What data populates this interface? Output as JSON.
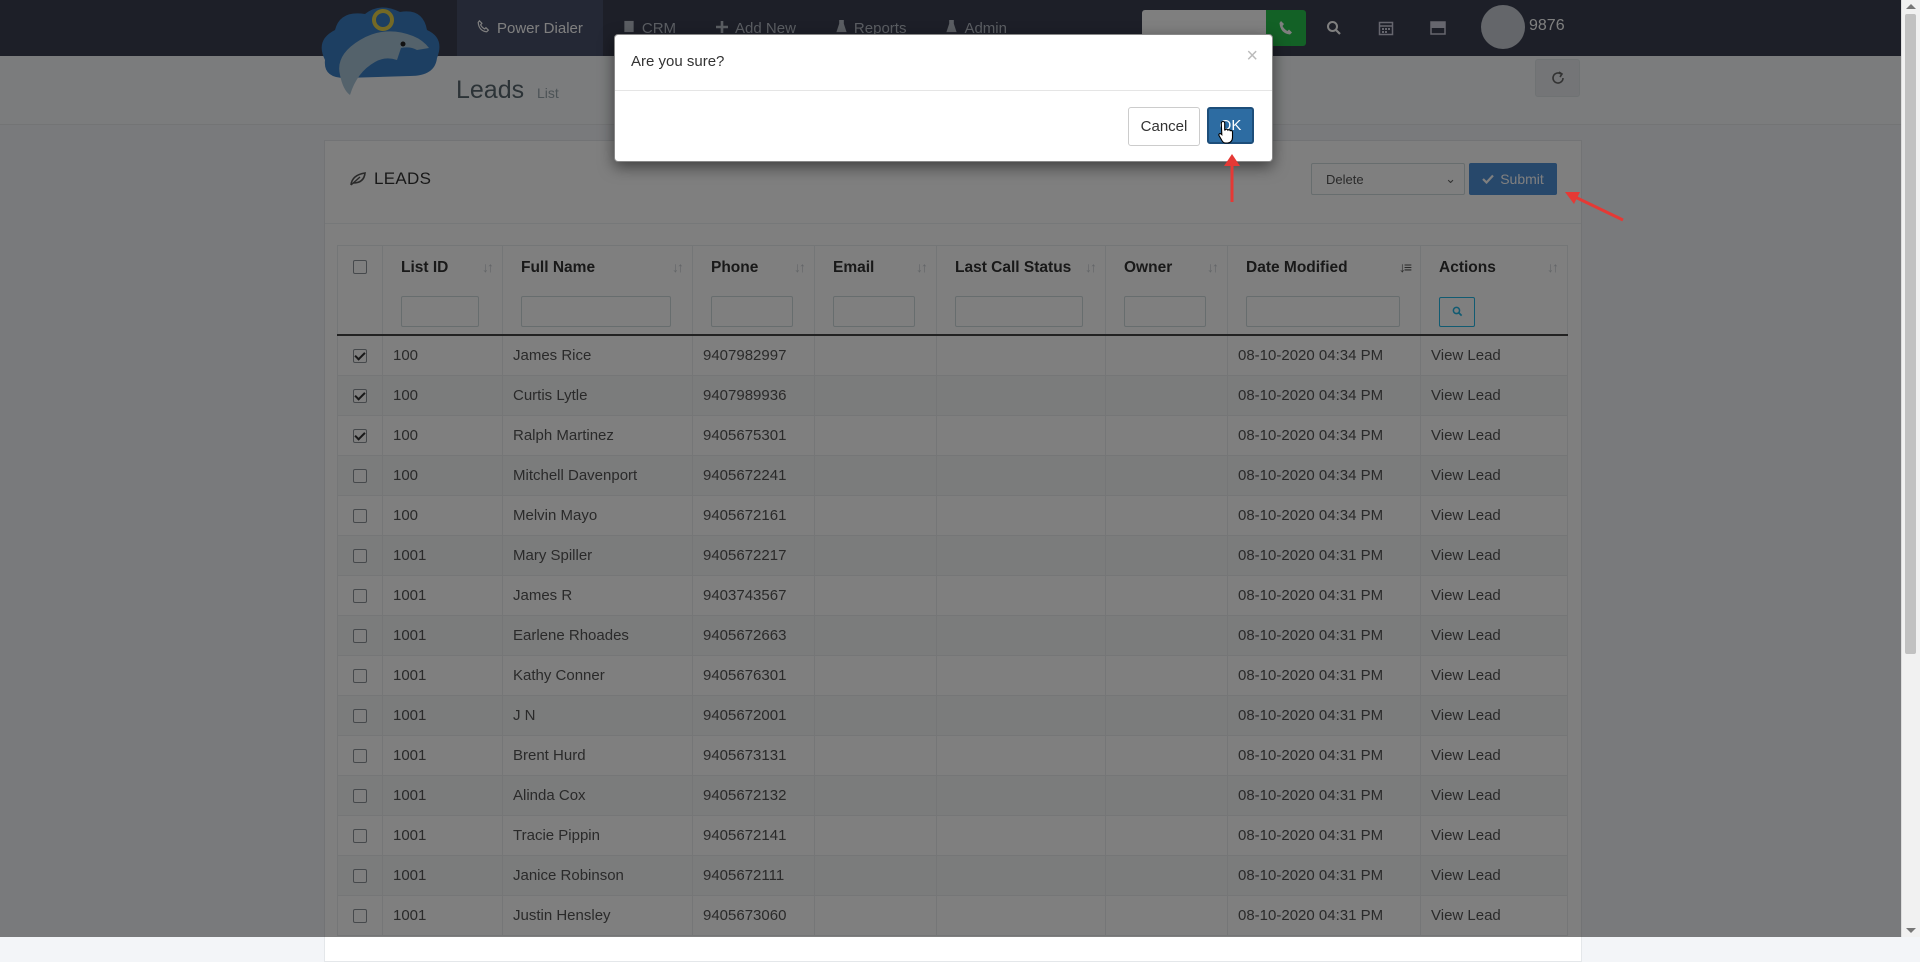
{
  "nav": {
    "items": [
      {
        "label": "Power Dialer",
        "icon": "phone-icon",
        "active": true
      },
      {
        "label": "CRM",
        "icon": "book-icon",
        "active": false
      },
      {
        "label": "Add New",
        "icon": "plus-icon",
        "active": false
      },
      {
        "label": "Reports",
        "icon": "flask-icon",
        "active": false
      },
      {
        "label": "Admin",
        "icon": "flask-icon",
        "active": false
      }
    ],
    "user_ext": "9876"
  },
  "header": {
    "title": "Leads",
    "subtitle": "List"
  },
  "panel": {
    "title": "LEADS",
    "action_selected": "Delete",
    "submit_label": "Submit"
  },
  "table": {
    "columns": [
      "List ID",
      "Full Name",
      "Phone",
      "Email",
      "Last Call Status",
      "Owner",
      "Date Modified",
      "Actions"
    ],
    "rows": [
      {
        "checked": true,
        "list_id": "100",
        "name": "James Rice",
        "phone": "9407982997",
        "email": "",
        "status": "",
        "owner": "",
        "date": "08-10-2020 04:34 PM",
        "action": "View Lead"
      },
      {
        "checked": true,
        "list_id": "100",
        "name": "Curtis Lytle",
        "phone": "9407989936",
        "email": "",
        "status": "",
        "owner": "",
        "date": "08-10-2020 04:34 PM",
        "action": "View Lead"
      },
      {
        "checked": true,
        "list_id": "100",
        "name": "Ralph Martinez",
        "phone": "9405675301",
        "email": "",
        "status": "",
        "owner": "",
        "date": "08-10-2020 04:34 PM",
        "action": "View Lead"
      },
      {
        "checked": false,
        "list_id": "100",
        "name": "Mitchell Davenport",
        "phone": "9405672241",
        "email": "",
        "status": "",
        "owner": "",
        "date": "08-10-2020 04:34 PM",
        "action": "View Lead"
      },
      {
        "checked": false,
        "list_id": "100",
        "name": "Melvin Mayo",
        "phone": "9405672161",
        "email": "",
        "status": "",
        "owner": "",
        "date": "08-10-2020 04:34 PM",
        "action": "View Lead"
      },
      {
        "checked": false,
        "list_id": "1001",
        "name": "Mary Spiller",
        "phone": "9405672217",
        "email": "",
        "status": "",
        "owner": "",
        "date": "08-10-2020 04:31 PM",
        "action": "View Lead"
      },
      {
        "checked": false,
        "list_id": "1001",
        "name": "James R",
        "phone": "9403743567",
        "email": "",
        "status": "",
        "owner": "",
        "date": "08-10-2020 04:31 PM",
        "action": "View Lead"
      },
      {
        "checked": false,
        "list_id": "1001",
        "name": "Earlene Rhoades",
        "phone": "9405672663",
        "email": "",
        "status": "",
        "owner": "",
        "date": "08-10-2020 04:31 PM",
        "action": "View Lead"
      },
      {
        "checked": false,
        "list_id": "1001",
        "name": "Kathy Conner",
        "phone": "9405676301",
        "email": "",
        "status": "",
        "owner": "",
        "date": "08-10-2020 04:31 PM",
        "action": "View Lead"
      },
      {
        "checked": false,
        "list_id": "1001",
        "name": "J N",
        "phone": "9405672001",
        "email": "",
        "status": "",
        "owner": "",
        "date": "08-10-2020 04:31 PM",
        "action": "View Lead"
      },
      {
        "checked": false,
        "list_id": "1001",
        "name": "Brent Hurd",
        "phone": "9405673131",
        "email": "",
        "status": "",
        "owner": "",
        "date": "08-10-2020 04:31 PM",
        "action": "View Lead"
      },
      {
        "checked": false,
        "list_id": "1001",
        "name": "Alinda Cox",
        "phone": "9405672132",
        "email": "",
        "status": "",
        "owner": "",
        "date": "08-10-2020 04:31 PM",
        "action": "View Lead"
      },
      {
        "checked": false,
        "list_id": "1001",
        "name": "Tracie Pippin",
        "phone": "9405672141",
        "email": "",
        "status": "",
        "owner": "",
        "date": "08-10-2020 04:31 PM",
        "action": "View Lead"
      },
      {
        "checked": false,
        "list_id": "1001",
        "name": "Janice Robinson",
        "phone": "9405672111",
        "email": "",
        "status": "",
        "owner": "",
        "date": "08-10-2020 04:31 PM",
        "action": "View Lead"
      },
      {
        "checked": false,
        "list_id": "1001",
        "name": "Justin Hensley",
        "phone": "9405673060",
        "email": "",
        "status": "",
        "owner": "",
        "date": "08-10-2020 04:31 PM",
        "action": "View Lead"
      }
    ]
  },
  "modal": {
    "title": "Are you sure?",
    "close": "×",
    "cancel_label": "Cancel",
    "ok_label": "OK"
  },
  "colors": {
    "navbar": "#3a3f51",
    "primary": "#2d6ca2",
    "annotation": "#e53935",
    "call_button": "#27c24c"
  }
}
